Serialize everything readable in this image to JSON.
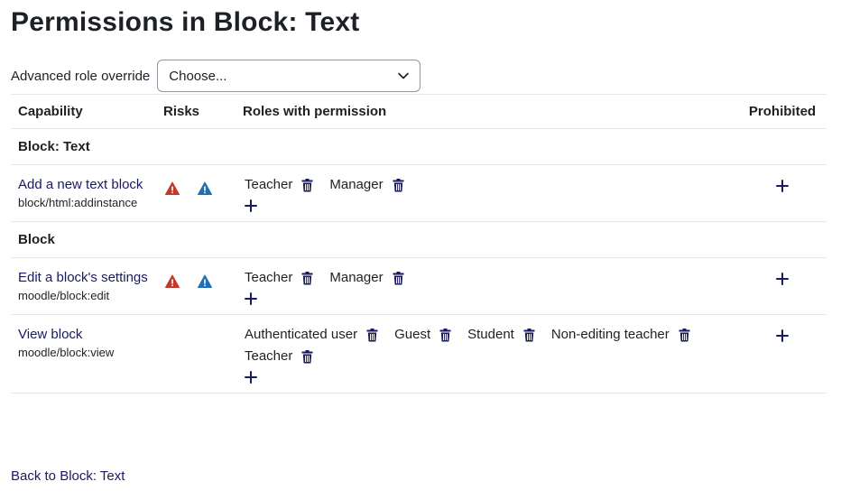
{
  "page": {
    "title": "Permissions in Block: Text"
  },
  "override": {
    "label": "Advanced role override",
    "selected": "Choose..."
  },
  "table": {
    "headers": {
      "capability": "Capability",
      "risks": "Risks",
      "roles": "Roles with permission",
      "prohibited": "Prohibited"
    },
    "groups": [
      {
        "title": "Block: Text",
        "capabilities": [
          {
            "label": "Add a new text block",
            "name": "block/html:addinstance",
            "risks": [
              "risk-xss-icon",
              "risk-config-icon"
            ],
            "roles": [
              "Teacher",
              "Manager"
            ]
          }
        ]
      },
      {
        "title": "Block",
        "capabilities": [
          {
            "label": "Edit a block's settings",
            "name": "moodle/block:edit",
            "risks": [
              "risk-xss-icon",
              "risk-config-icon"
            ],
            "roles": [
              "Teacher",
              "Manager"
            ]
          },
          {
            "label": "View block",
            "name": "moodle/block:view",
            "risks": [],
            "roles": [
              "Authenticated user",
              "Guest",
              "Student",
              "Non-editing teacher",
              "Teacher"
            ]
          }
        ]
      }
    ]
  },
  "footer": {
    "back_link": "Back to Block: Text"
  },
  "colors": {
    "link": "#1a1a5e",
    "risk_red": "#c0392b",
    "risk_blue": "#1f6fb5",
    "icon": "#1a1a5e",
    "border": "#e6e6e6"
  }
}
